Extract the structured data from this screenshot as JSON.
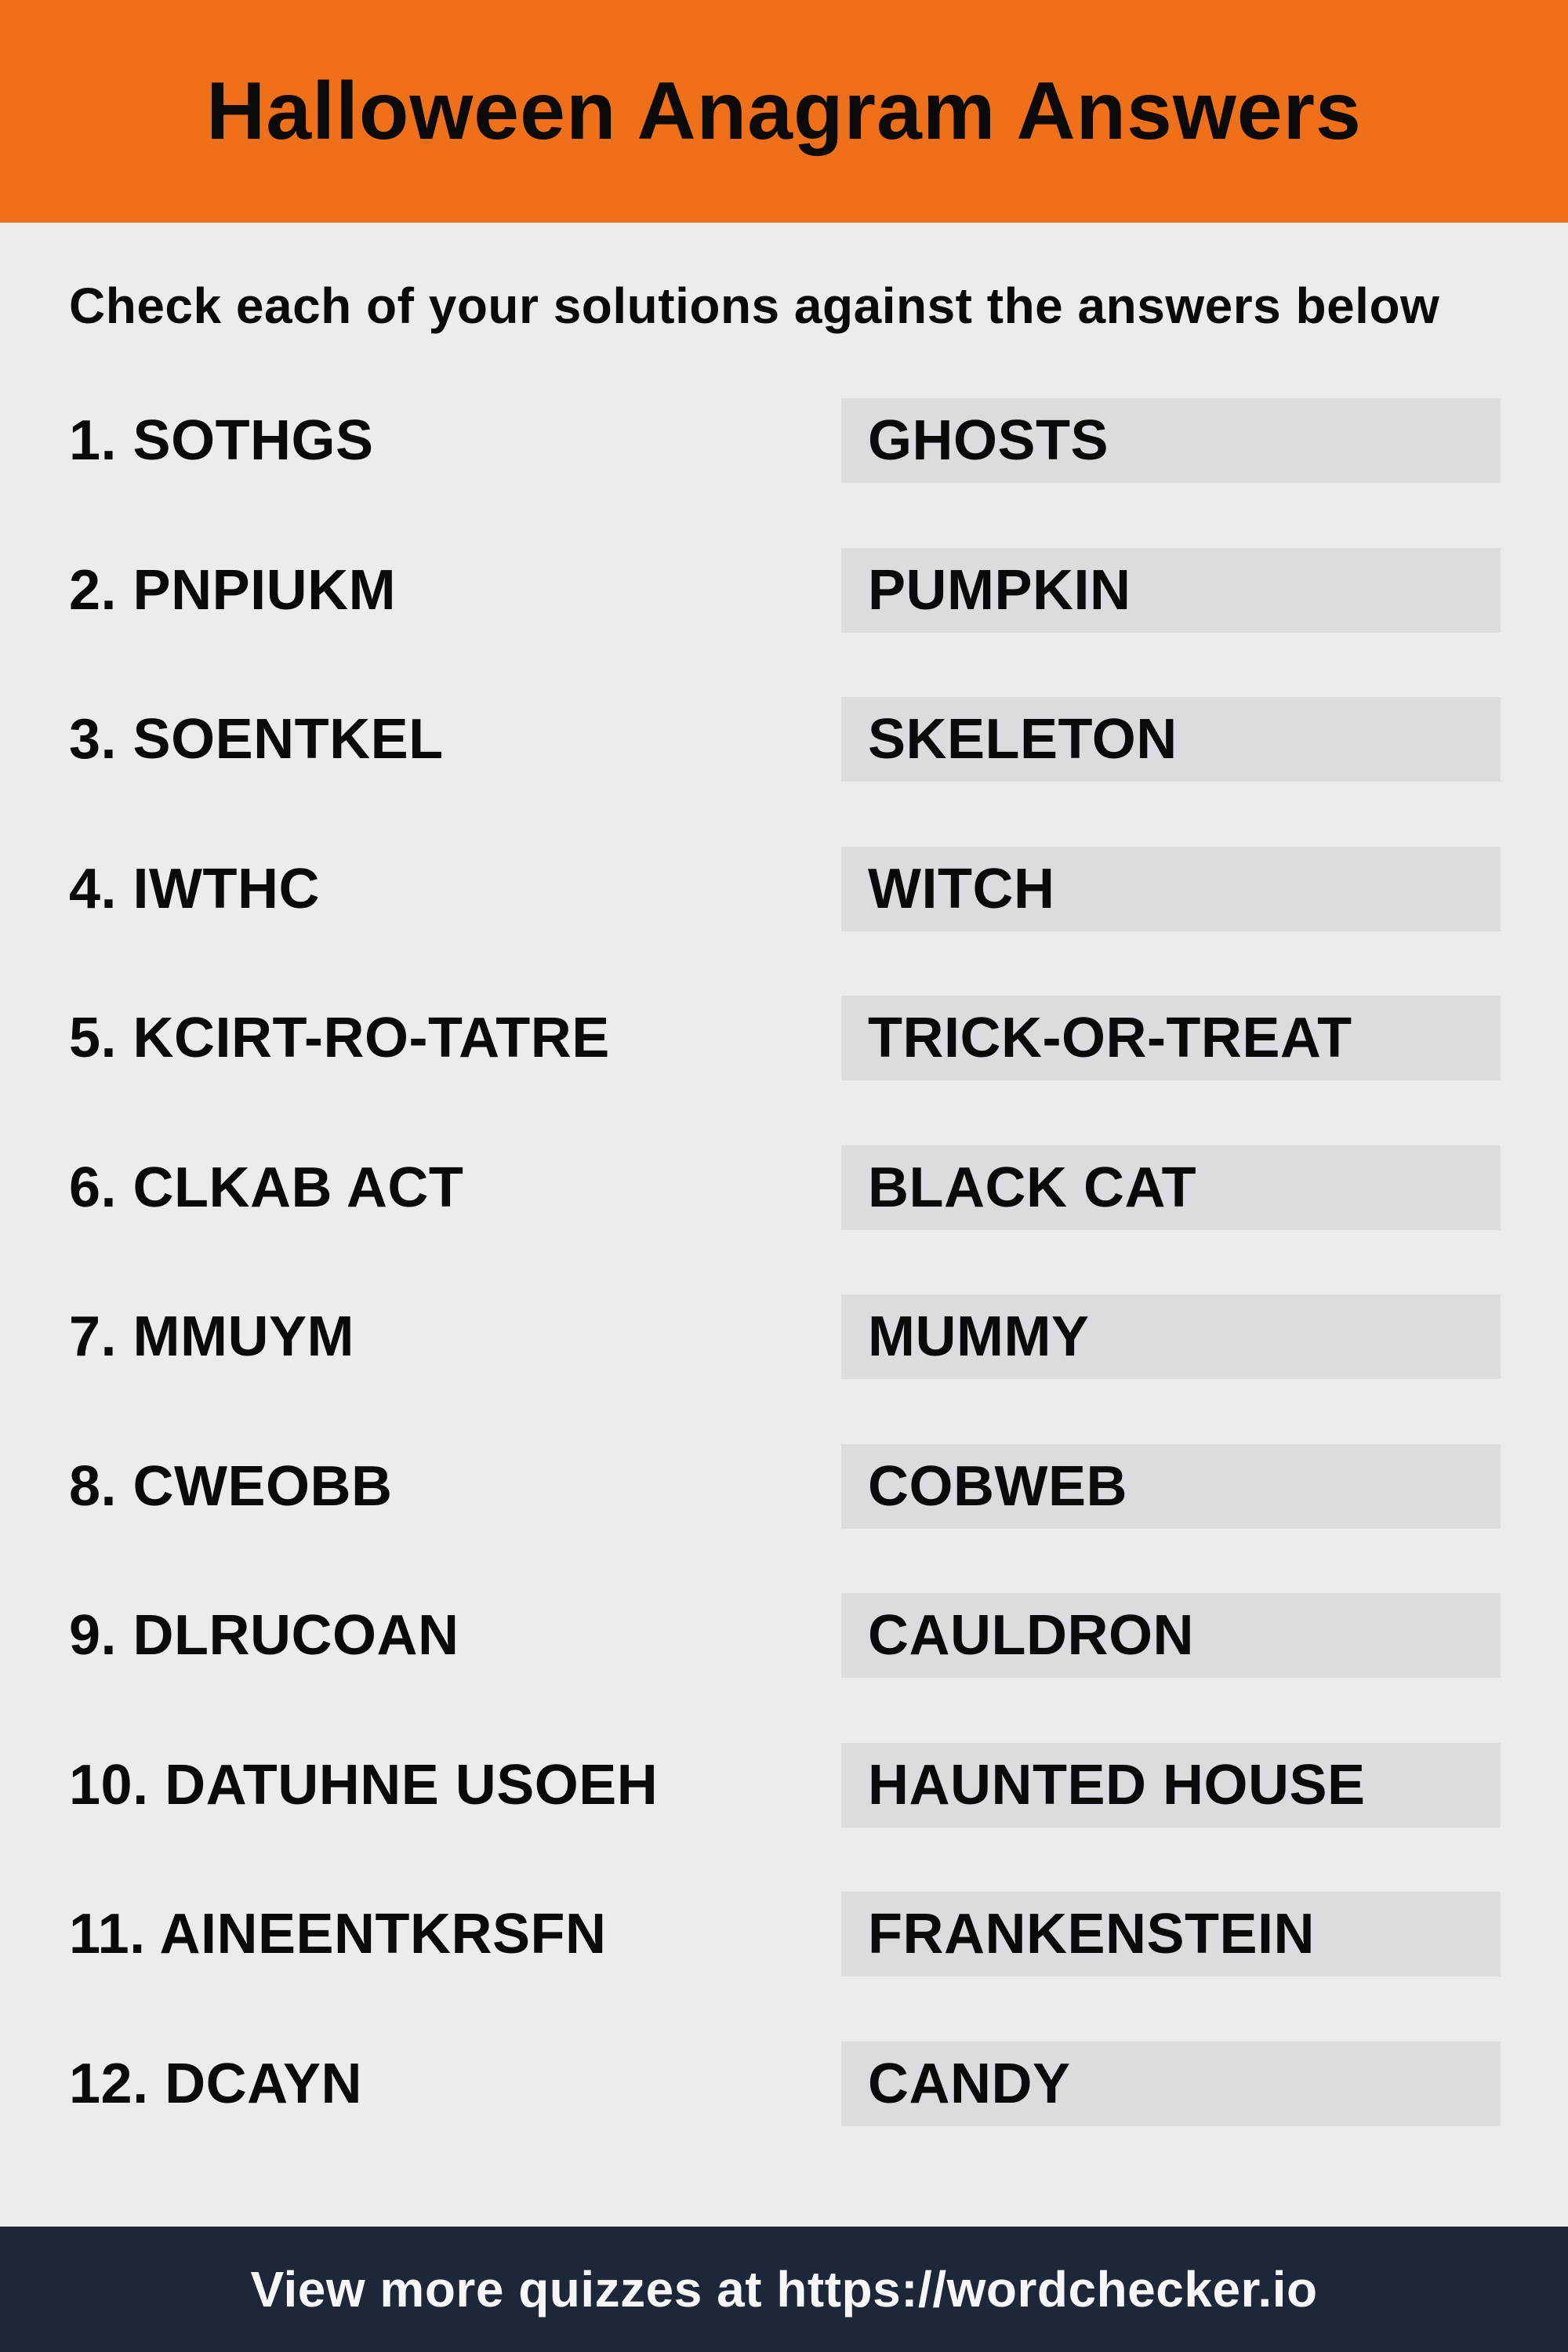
{
  "header": {
    "title": "Halloween Anagram Answers"
  },
  "subtitle": "Check each of your solutions against the answers below",
  "rows": [
    {
      "anagram": "1. SOTHGS",
      "answer": "GHOSTS"
    },
    {
      "anagram": "2. PNPIUKM",
      "answer": "PUMPKIN"
    },
    {
      "anagram": "3. SOENTKEL",
      "answer": "SKELETON"
    },
    {
      "anagram": "4. IWTHC",
      "answer": "WITCH"
    },
    {
      "anagram": "5. KCIRT-RO-TATRE",
      "answer": "TRICK-OR-TREAT"
    },
    {
      "anagram": "6. CLKAB ACT",
      "answer": "BLACK CAT"
    },
    {
      "anagram": "7. MMUYM",
      "answer": "MUMMY"
    },
    {
      "anagram": "8. CWEOBB",
      "answer": "COBWEB"
    },
    {
      "anagram": "9. DLRUCOAN",
      "answer": "CAULDRON"
    },
    {
      "anagram": "10. DATUHNE USOEH",
      "answer": "HAUNTED HOUSE"
    },
    {
      "anagram": "11. AINEENTKRSFN",
      "answer": "FRANKENSTEIN"
    },
    {
      "anagram": "12. DCAYN",
      "answer": "CANDY"
    }
  ],
  "footer": {
    "text": "View more quizzes at https://wordchecker.io"
  },
  "colors": {
    "header_bg": "#EF7019",
    "page_bg": "#ECECEE",
    "answer_box_bg": "#DCDCE0",
    "footer_bg": "#1E2739",
    "footer_text": "#F6F6F6"
  }
}
